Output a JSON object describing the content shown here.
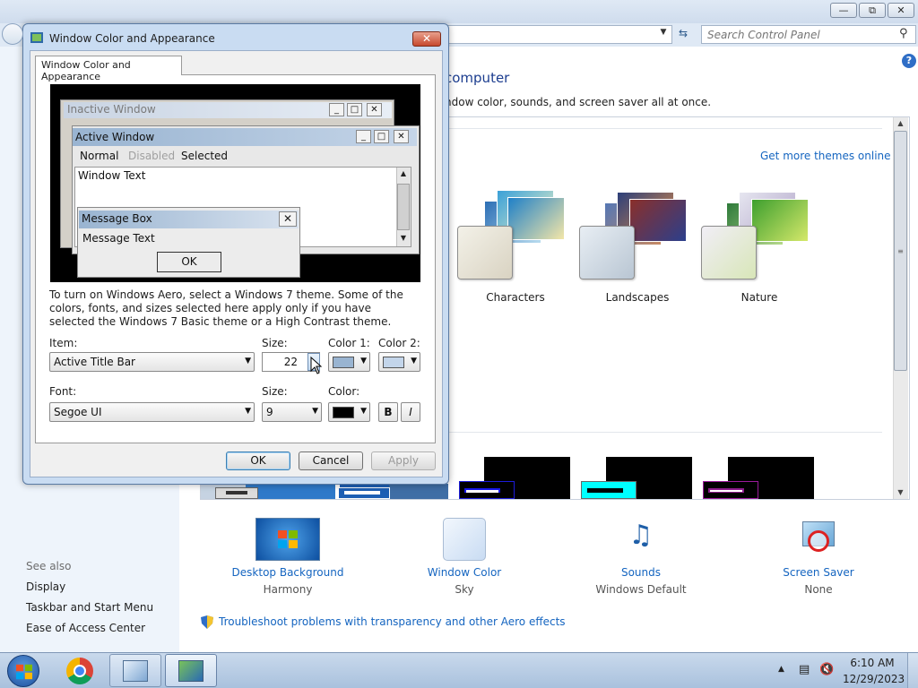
{
  "background_window": {
    "search_placeholder": "Search Control Panel",
    "heading": "computer",
    "subtext": "ndow color, sounds, and screen saver all at once.",
    "get_more_themes": "Get more themes online",
    "themes": [
      {
        "label": "Characters"
      },
      {
        "label": "Landscapes"
      },
      {
        "label": "Nature"
      }
    ],
    "bottom_items": [
      {
        "link": "Desktop Background",
        "value": "Harmony"
      },
      {
        "link": "Window Color",
        "value": "Sky"
      },
      {
        "link": "Sounds",
        "value": "Windows Default"
      },
      {
        "link": "Screen Saver",
        "value": "None"
      }
    ],
    "see_also": {
      "title": "See also",
      "links": [
        "Display",
        "Taskbar and Start Menu",
        "Ease of Access Center"
      ]
    },
    "troubleshoot": "Troubleshoot problems with transparency and other Aero effects"
  },
  "dialog": {
    "title": "Window Color and Appearance",
    "tab": "Window Color and Appearance",
    "preview": {
      "inactive_title": "Inactive Window",
      "active_title": "Active Window",
      "menu_normal": "Normal",
      "menu_disabled": "Disabled",
      "menu_selected": "Selected",
      "window_text": "Window Text",
      "message_box_title": "Message Box",
      "message_text": "Message Text",
      "ok": "OK"
    },
    "explanation": "To turn on Windows Aero, select a Windows 7 theme.  Some of the colors, fonts, and sizes selected here apply only if you have selected the Windows 7 Basic theme or a High Contrast theme.",
    "item_label": "Item:",
    "item_value": "Active Title Bar",
    "size_label": "Size:",
    "size_value": "22",
    "color1_label": "Color 1:",
    "color2_label": "Color 2:",
    "color1": "#99b4d1",
    "color2": "#c3d5ea",
    "font_label": "Font:",
    "font_value": "Segoe UI",
    "font_size_label": "Size:",
    "font_size_value": "9",
    "font_color_label": "Color:",
    "font_color": "#000000",
    "bold": "B",
    "italic": "I",
    "ok": "OK",
    "cancel": "Cancel",
    "apply": "Apply"
  },
  "taskbar": {
    "time": "6:10 AM",
    "date": "12/29/2023"
  },
  "colors": {
    "link": "#1565c0",
    "active_title": "#99b4d1",
    "taskbar": "#b8cde6"
  }
}
